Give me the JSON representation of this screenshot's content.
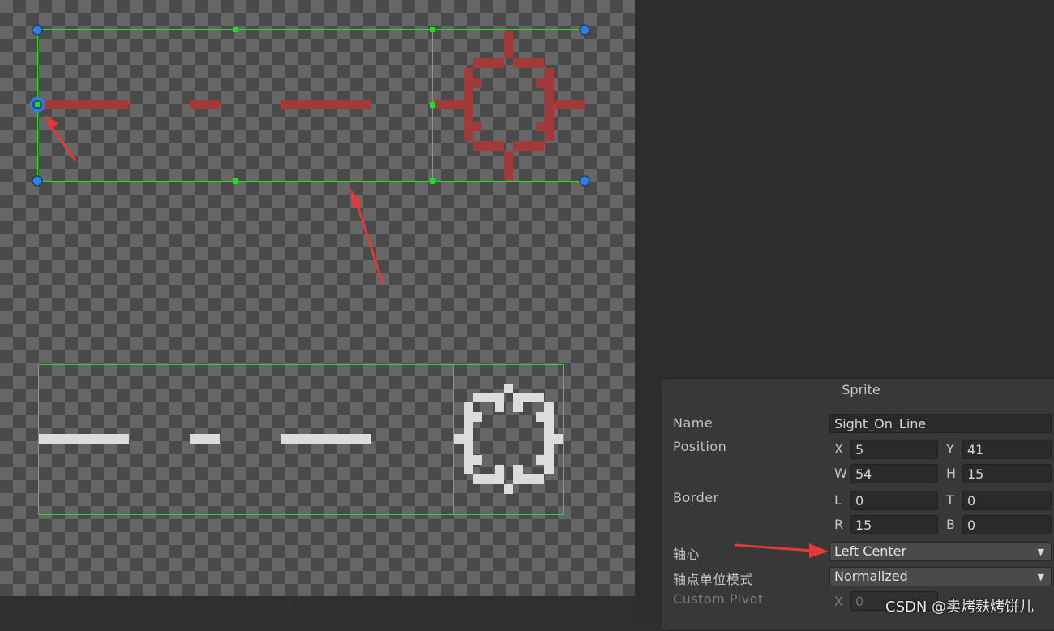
{
  "panel": {
    "title": "Sprite",
    "name_label": "Name",
    "name_value": "Sight_On_Line",
    "position_label": "Position",
    "position": {
      "x_label": "X",
      "x": "5",
      "y_label": "Y",
      "y": "41",
      "w_label": "W",
      "w": "54",
      "h_label": "H",
      "h": "15"
    },
    "border_label": "Border",
    "border": {
      "l_label": "L",
      "l": "0",
      "t_label": "T",
      "t": "0",
      "r_label": "R",
      "r": "15",
      "b_label": "B",
      "b": "0"
    },
    "pivot_label": "轴心",
    "pivot_value": "Left Center",
    "pivot_unit_label": "轴点单位模式",
    "pivot_unit_value": "Normalized",
    "custom_pivot_label": "Custom Pivot",
    "custom_pivot": {
      "x_label": "X",
      "x": "0"
    }
  },
  "watermark": "CSDN @卖烤麸烤饼儿",
  "colors": {
    "guide_green": "#22dd22",
    "sprite_red": "#a33a3a",
    "sprite_white": "#dcdcdc",
    "pivot_blue": "#2f7fe0",
    "arrow_red": "#e23a36"
  }
}
